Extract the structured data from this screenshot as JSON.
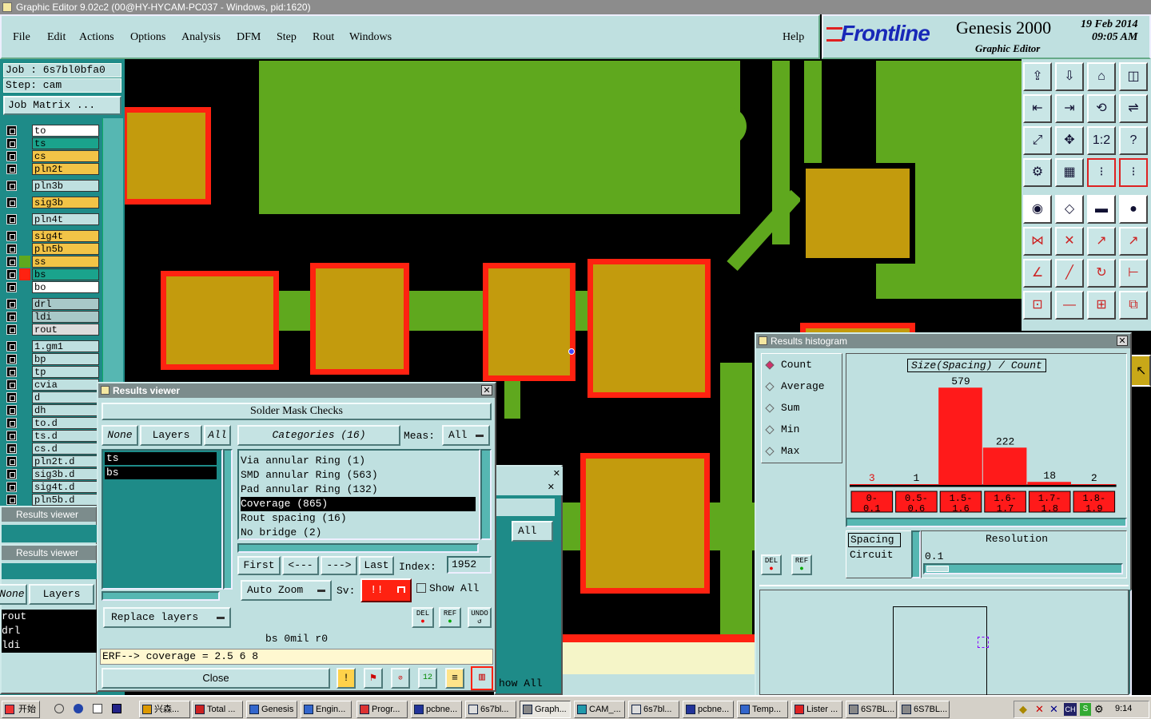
{
  "window_title": "Graphic Editor 9.02c2 (00@HY-HYCAM-PC037 - Windows, pid:1620)",
  "menu": {
    "items": [
      "File",
      "Edit",
      "Actions",
      "Options",
      "Analysis",
      "DFM",
      "Step",
      "Rout",
      "Windows"
    ],
    "help": "Help"
  },
  "brand": {
    "logo": "Frontline",
    "product": "Genesis 2000",
    "subtitle": "Graphic Editor",
    "date": "19 Feb 2014",
    "time": "09:05 AM"
  },
  "job": {
    "job_line": "Job : 6s7bl0bfa0",
    "step_line": "Step: cam",
    "matrix_button": "Job Matrix ..."
  },
  "layers": [
    {
      "name": "to",
      "color": "#ffffff"
    },
    {
      "name": "ts",
      "color": "#1aa38c"
    },
    {
      "name": "cs",
      "color": "#f2c447"
    },
    {
      "name": "pln2t",
      "color": "#f2c447"
    },
    {
      "name": "pln3b",
      "color": "#bfe0e0"
    },
    {
      "name": "sig3b",
      "color": "#f2c447"
    },
    {
      "name": "pln4t",
      "color": "#bfe0e0"
    },
    {
      "name": "sig4t",
      "color": "#f2c447"
    },
    {
      "name": "pln5b",
      "color": "#f2c447"
    },
    {
      "name": "ss",
      "color": "#f2c447"
    },
    {
      "name": "bs",
      "color": "#1aa38c"
    },
    {
      "name": "bo",
      "color": "#ffffff"
    },
    {
      "name": "drl",
      "color": "#a8c8c8"
    },
    {
      "name": "ldi",
      "color": "#a8c8c8"
    },
    {
      "name": "rout",
      "color": "#dcdcdc"
    },
    {
      "name": "1.gm1",
      "color": "#bfe0e0"
    },
    {
      "name": "bp",
      "color": "#bfe0e0"
    },
    {
      "name": "tp",
      "color": "#bfe0e0"
    },
    {
      "name": "cvia",
      "color": "#bfe0e0"
    },
    {
      "name": "d",
      "color": "#bfe0e0"
    },
    {
      "name": "dh",
      "color": "#bfe0e0"
    },
    {
      "name": "to.d",
      "color": "#bfe0e0"
    },
    {
      "name": "ts.d",
      "color": "#bfe0e0"
    },
    {
      "name": "cs.d",
      "color": "#bfe0e0"
    },
    {
      "name": "pln2t.d",
      "color": "#bfe0e0"
    },
    {
      "name": "sig3b.d",
      "color": "#bfe0e0"
    },
    {
      "name": "sig4t.d",
      "color": "#bfe0e0"
    },
    {
      "name": "pln5b.d",
      "color": "#bfe0e0"
    }
  ],
  "behind_windows": {
    "title1": "Results viewer",
    "title2": "Results viewer",
    "none": "None",
    "layers": "Layers",
    "items": [
      "rout",
      "drl",
      "ldi"
    ],
    "all": "All",
    "show_all": "how All"
  },
  "results_viewer": {
    "title": "Results viewer",
    "header": "Solder Mask Checks",
    "none_btn": "None",
    "layers_btn": "Layers",
    "all_btn": "All",
    "layers_list": [
      "ts",
      "bs"
    ],
    "categories_btn": "Categories (16)",
    "meas_label": "Meas:",
    "meas_value": "All",
    "categories": [
      "Via annular Ring (1)",
      "SMD annular Ring (563)",
      "Pad annular Ring (132)",
      "Coverage (865)",
      "Rout spacing (16)",
      "No bridge (2)"
    ],
    "selected_category": "Coverage (865)",
    "first": "First",
    "prev": "<---",
    "next": "--->",
    "last": "Last",
    "index_label": "Index:",
    "index_value": "1952",
    "auto_zoom": "Auto Zoom",
    "sv_label": "Sv:",
    "sv_value": "!!",
    "show_all": "Show All",
    "replace_layers": "Replace layers",
    "del": "DEL",
    "ref": "REF",
    "undo": "UNDO",
    "status": "bs 0mil r0",
    "erf": "ERF--> coverage = 2.5 6 8",
    "close": "Close"
  },
  "histogram": {
    "title": "Results histogram",
    "modes": [
      "Count",
      "Average",
      "Sum",
      "Min",
      "Max"
    ],
    "selected_mode": "Count",
    "chart_title": "Size(Spacing) / Count",
    "del": "DEL",
    "ref": "REF",
    "spacing": "Spacing",
    "circuit": "Circuit",
    "resolution_label": "Resolution",
    "resolution_value": "0.1"
  },
  "chart_data": {
    "type": "bar",
    "title": "Size(Spacing) / Count",
    "categories": [
      "0-0.1",
      "0.5-0.6",
      "1.5-1.6",
      "1.6-1.7",
      "1.7-1.8",
      "1.8-1.9"
    ],
    "category_labels": [
      [
        "0-",
        "0.1"
      ],
      [
        "0.5-",
        "0.6"
      ],
      [
        "1.5-",
        "1.6"
      ],
      [
        "1.6-",
        "1.7"
      ],
      [
        "1.7-",
        "1.8"
      ],
      [
        "1.8-",
        "1.9"
      ]
    ],
    "values": [
      3,
      1,
      579,
      222,
      18,
      2
    ],
    "bar_color": "#ff1a1a",
    "first_label_color": "#e01010"
  },
  "taskbar": {
    "start": "开始",
    "tasks": [
      "兴森...",
      "Total ...",
      "Genesis",
      "Engin...",
      "Progr...",
      "pcbne...",
      "6s7bl...",
      "Graph...",
      "CAM_...",
      "6s7bl...",
      "pcbne...",
      "Temp...",
      "Lister ...",
      "6S7BL...",
      "6S7BL..."
    ],
    "clock": "9:14"
  }
}
